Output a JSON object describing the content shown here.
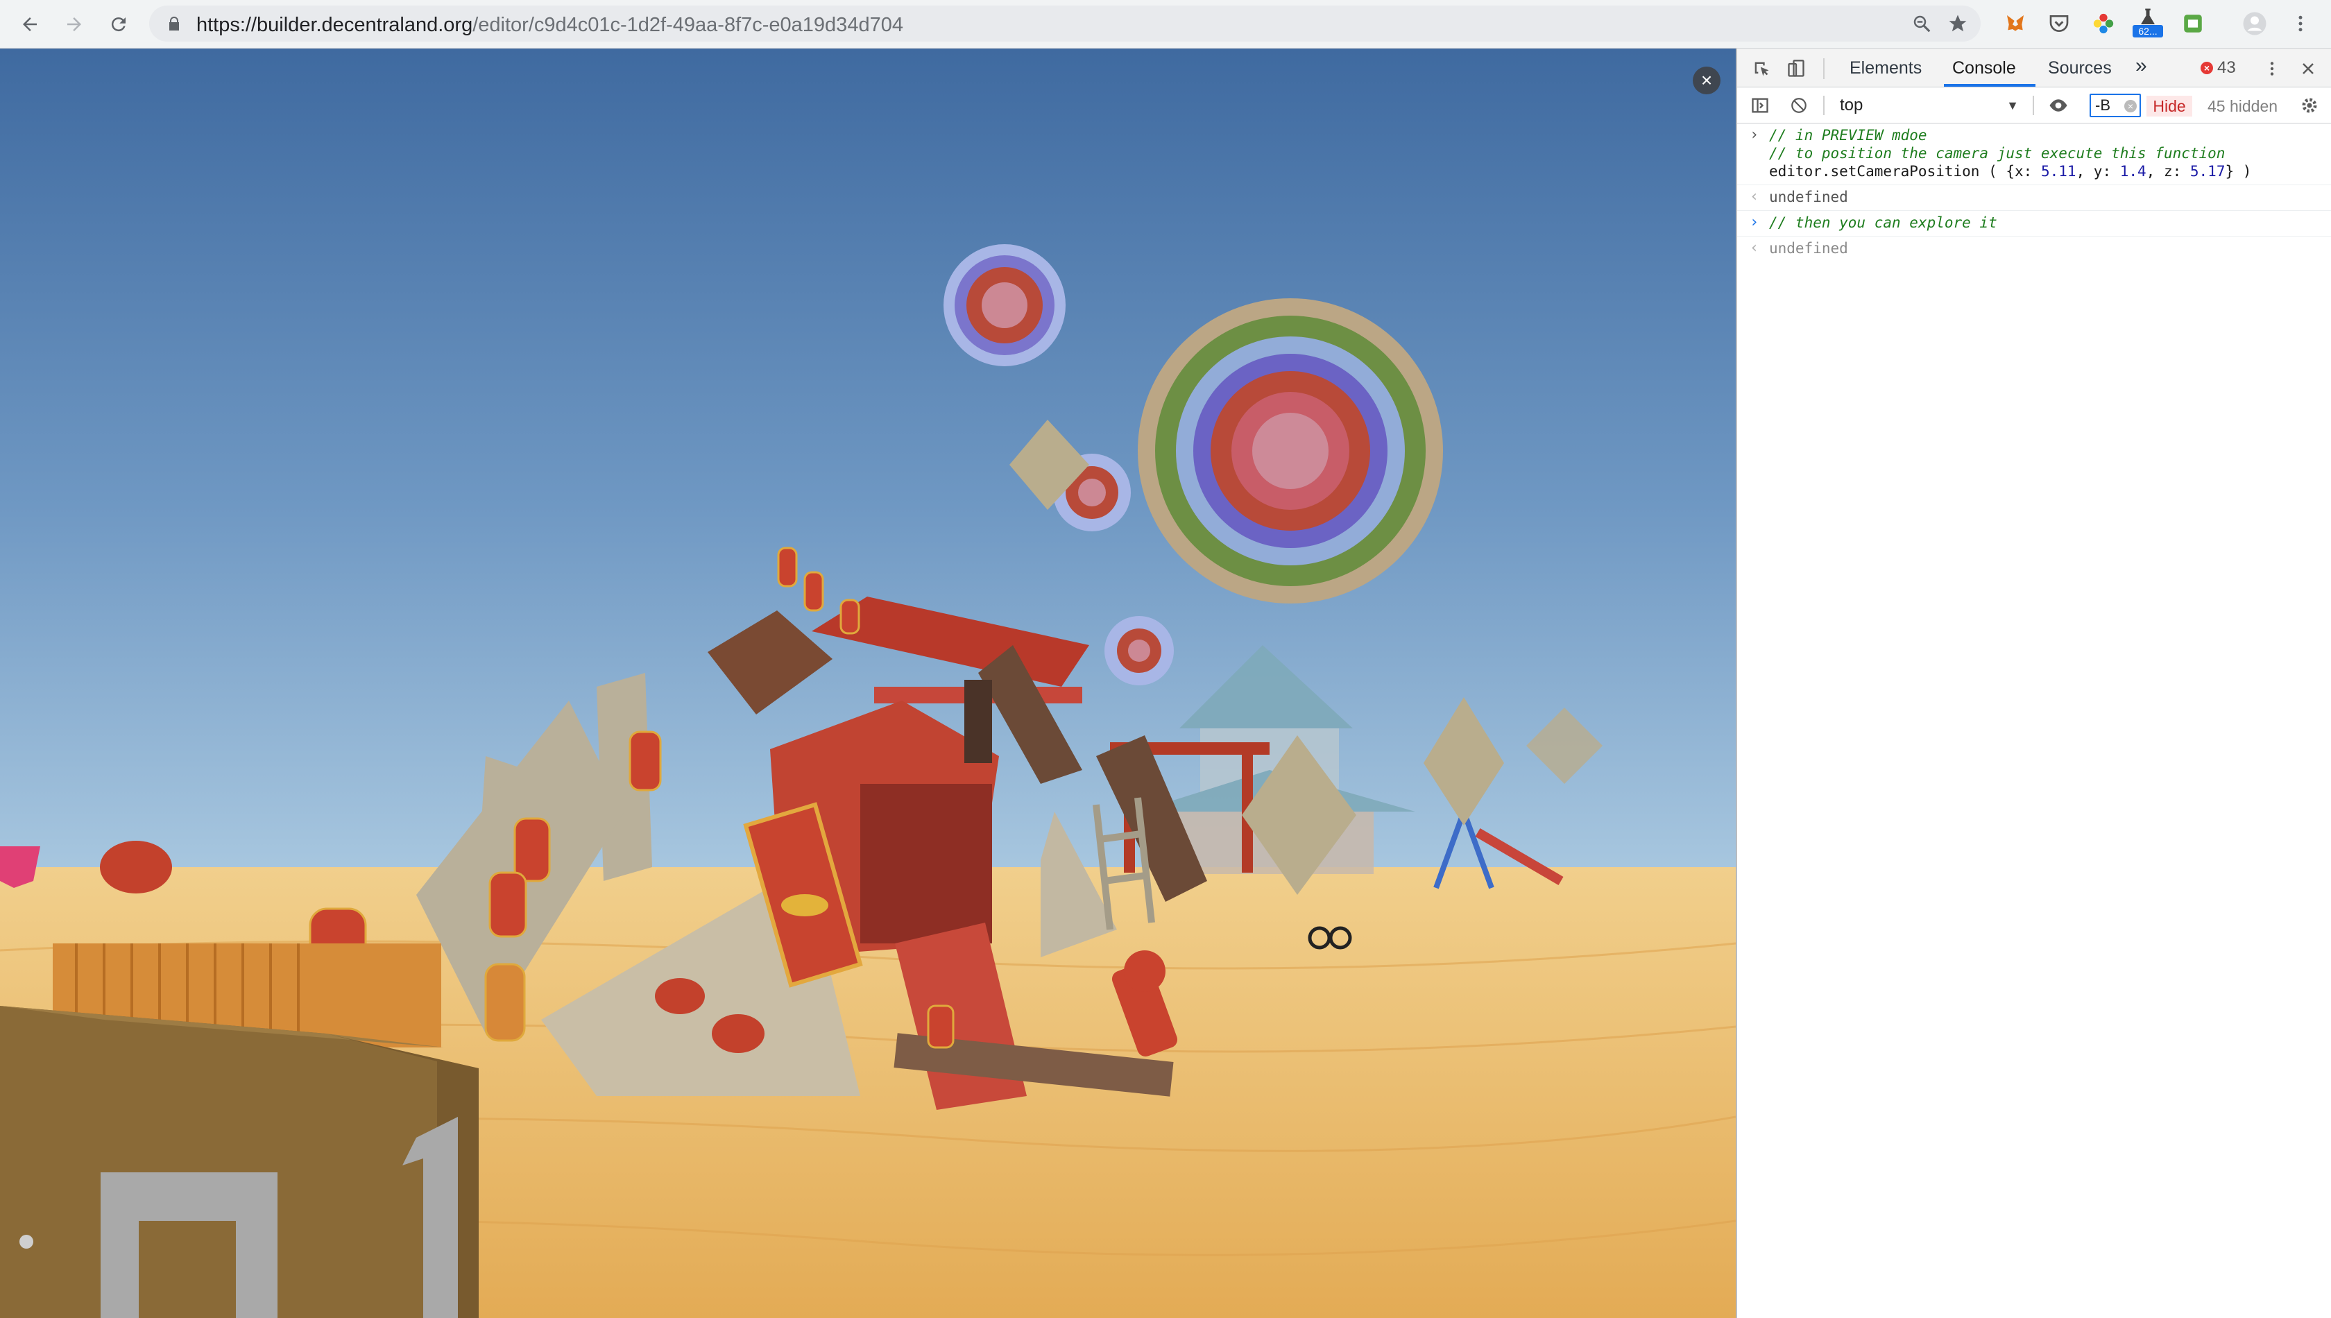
{
  "browser": {
    "url_host": "https://builder.decentraland.org",
    "url_path": "/editor/c9d4c01c-1d2f-49aa-8f7c-e0a19d34d704",
    "extension_badge": "62..."
  },
  "preview": {
    "close_label": "×"
  },
  "devtools": {
    "tabs": [
      {
        "label": "Elements"
      },
      {
        "label": "Console"
      },
      {
        "label": "Sources"
      }
    ],
    "more_tabs": "»",
    "error_count": "43",
    "context": "top",
    "filter_value": "-B",
    "hide_label": "Hide",
    "hidden_count": "45 hidden",
    "console": {
      "entry1": {
        "line1": "// in PREVIEW mdoe",
        "line2": "// to position the camera just execute this function",
        "call_prefix": "editor.setCameraPosition ( {x: ",
        "x": "5.11",
        "y_label": ", y: ",
        "y": "1.4",
        "z_label": ", z: ",
        "z": "5.17",
        "call_suffix": "} )"
      },
      "result1": "undefined",
      "entry2": "// then you can explore it",
      "result2": "undefined"
    }
  },
  "colors": {
    "sky_top": "#3f6aa0",
    "sky_horizon": "#9fc0dc",
    "sand": "#e9b969",
    "accent_blue": "#1a73e8",
    "error_red": "#e53935"
  }
}
